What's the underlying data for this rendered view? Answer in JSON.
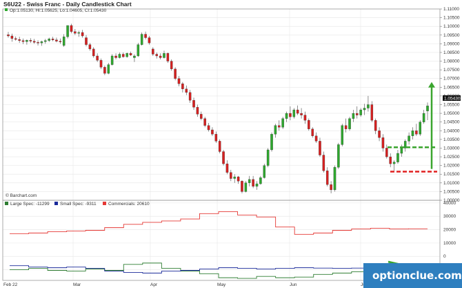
{
  "chart_data": [
    {
      "type": "candlestick",
      "title": "S6U22 - Swiss Franc - Daily Candlestick Chart",
      "ohlc_label": "Op:1.05130, Hi:1.05625, Lo:1.04605, Cl:1.05430",
      "last_price_label": "1.05430",
      "credit": "© Barchart.com",
      "ylim": [
        1.0,
        1.11
      ],
      "y_ticks": [
        "1.00000",
        "1.00500",
        "1.01000",
        "1.01500",
        "1.02000",
        "1.02500",
        "1.03000",
        "1.03500",
        "1.04000",
        "1.04500",
        "1.05000",
        "1.05500",
        "1.06000",
        "1.06500",
        "1.07000",
        "1.07500",
        "1.08000",
        "1.08500",
        "1.09000",
        "1.09500",
        "1.10000",
        "1.10500",
        "1.11000"
      ],
      "x_ticks": [
        "Feb 22",
        "Mar",
        "Apr",
        "May",
        "Jun",
        "Jul"
      ],
      "up_color": "#2ea82e",
      "down_color": "#d62020",
      "candles": [
        [
          1.0952,
          1.0968,
          1.0935,
          1.0945
        ],
        [
          1.0945,
          1.0958,
          1.0912,
          1.093
        ],
        [
          1.093,
          1.0942,
          1.0918,
          1.0925
        ],
        [
          1.0925,
          1.094,
          1.0905,
          1.0918
        ],
        [
          1.0918,
          1.093,
          1.0898,
          1.0912
        ],
        [
          1.0912,
          1.0925,
          1.0895,
          1.092
        ],
        [
          1.092,
          1.0932,
          1.0905,
          1.0915
        ],
        [
          1.0915,
          1.0928,
          1.09,
          1.0908
        ],
        [
          1.0908,
          1.092,
          1.089,
          1.0905
        ],
        [
          1.0905,
          1.0918,
          1.0888,
          1.0912
        ],
        [
          1.0912,
          1.0928,
          1.09,
          1.0918
        ],
        [
          1.0918,
          1.0935,
          1.091,
          1.0928
        ],
        [
          1.0928,
          1.094,
          1.0915,
          1.0922
        ],
        [
          1.0922,
          1.0935,
          1.0908,
          1.0915
        ],
        [
          1.0915,
          1.093,
          1.09,
          1.091
        ],
        [
          1.089,
          1.0955,
          1.0882,
          1.094
        ],
        [
          1.094,
          1.098,
          1.093,
          1.1005
        ],
        [
          1.1005,
          1.1015,
          1.096,
          1.097
        ],
        [
          1.097,
          1.0985,
          1.095,
          1.096
        ],
        [
          1.096,
          1.0975,
          1.094,
          1.0965
        ],
        [
          1.0965,
          1.098,
          1.0935,
          1.0945
        ],
        [
          1.0935,
          1.095,
          1.0885,
          1.0895
        ],
        [
          1.0895,
          1.0905,
          1.086,
          1.087
        ],
        [
          1.087,
          1.088,
          1.082,
          1.083
        ],
        [
          1.083,
          1.0845,
          1.0795,
          1.0805
        ],
        [
          1.0805,
          1.0815,
          1.0755,
          1.0765
        ],
        [
          1.0765,
          1.0775,
          1.072,
          1.073
        ],
        [
          1.073,
          1.079,
          1.0725,
          1.078
        ],
        [
          1.078,
          1.084,
          1.0775,
          1.083
        ],
        [
          1.083,
          1.0845,
          1.081,
          1.082
        ],
        [
          1.082,
          1.085,
          1.0815,
          1.084
        ],
        [
          1.084,
          1.085,
          1.082,
          1.0825
        ],
        [
          1.0825,
          1.085,
          1.082,
          1.0845
        ],
        [
          1.0845,
          1.0855,
          1.083,
          1.0835
        ],
        [
          1.082,
          1.084,
          1.0795,
          1.083
        ],
        [
          1.083,
          1.0905,
          1.0825,
          1.0895
        ],
        [
          1.0895,
          1.0965,
          1.089,
          1.0955
        ],
        [
          1.0955,
          1.097,
          1.0925,
          1.0935
        ],
        [
          1.0935,
          1.0945,
          1.0895,
          1.0905
        ],
        [
          1.087,
          1.088,
          1.083,
          1.084
        ],
        [
          1.084,
          1.085,
          1.0815,
          1.083
        ],
        [
          1.083,
          1.0845,
          1.081,
          1.082
        ],
        [
          1.082,
          1.086,
          1.0815,
          1.0845
        ],
        [
          1.0845,
          1.085,
          1.079,
          1.08
        ],
        [
          1.08,
          1.081,
          1.0745,
          1.0755
        ],
        [
          1.0755,
          1.0765,
          1.069,
          1.07
        ],
        [
          1.07,
          1.0715,
          1.0655,
          1.067
        ],
        [
          1.067,
          1.068,
          1.062,
          1.064
        ],
        [
          1.064,
          1.066,
          1.0605,
          1.062
        ],
        [
          1.062,
          1.0635,
          1.056,
          1.0575
        ],
        [
          1.0575,
          1.059,
          1.052,
          1.0535
        ],
        [
          1.0535,
          1.055,
          1.048,
          1.0495
        ],
        [
          1.0495,
          1.051,
          1.046,
          1.047
        ],
        [
          1.047,
          1.048,
          1.042,
          1.043
        ],
        [
          1.043,
          1.0445,
          1.0395,
          1.0405
        ],
        [
          1.0405,
          1.042,
          1.037,
          1.038
        ],
        [
          1.038,
          1.0395,
          1.033,
          1.034
        ],
        [
          1.034,
          1.035,
          1.027,
          1.028
        ],
        [
          1.028,
          1.029,
          1.02,
          1.021
        ],
        [
          1.021,
          1.023,
          1.015,
          1.016
        ],
        [
          1.016,
          1.0175,
          1.011,
          1.0125
        ],
        [
          1.0125,
          1.015,
          1.01,
          1.0135
        ],
        [
          1.0135,
          1.014,
          1.0095,
          1.011
        ],
        [
          1.011,
          1.0115,
          1.004,
          1.005
        ],
        [
          1.005,
          1.011,
          1.0045,
          1.01
        ],
        [
          1.01,
          1.014,
          1.008,
          1.012
        ],
        [
          1.012,
          1.014,
          1.007,
          1.008
        ],
        [
          1.008,
          1.011,
          1.006,
          1.0095
        ],
        [
          1.0095,
          1.014,
          1.009,
          1.013
        ],
        [
          1.013,
          1.021,
          1.0125,
          1.02
        ],
        [
          1.02,
          1.03,
          1.019,
          1.029
        ],
        [
          1.029,
          1.039,
          1.028,
          1.038
        ],
        [
          1.038,
          1.044,
          1.036,
          1.043
        ],
        [
          1.043,
          1.046,
          1.04,
          1.042
        ],
        [
          1.042,
          1.048,
          1.041,
          1.047
        ],
        [
          1.047,
          1.051,
          1.045,
          1.05
        ],
        [
          1.05,
          1.054,
          1.046,
          1.048
        ],
        [
          1.048,
          1.053,
          1.047,
          1.052
        ],
        [
          1.052,
          1.0545,
          1.049,
          1.05
        ],
        [
          1.05,
          1.053,
          1.047,
          1.049
        ],
        [
          1.049,
          1.051,
          1.044,
          1.046
        ],
        [
          1.046,
          1.047,
          1.04,
          1.041
        ],
        [
          1.041,
          1.042,
          1.036,
          1.037
        ],
        [
          1.037,
          1.039,
          1.033,
          1.034
        ],
        [
          1.034,
          1.036,
          1.025,
          1.026
        ],
        [
          1.026,
          1.028,
          1.016,
          1.017
        ],
        [
          1.017,
          1.019,
          1.008,
          1.009
        ],
        [
          1.009,
          1.011,
          1.004,
          1.006
        ],
        [
          1.006,
          1.02,
          1.005,
          1.019
        ],
        [
          1.019,
          1.033,
          1.018,
          1.032
        ],
        [
          1.032,
          1.044,
          1.031,
          1.043
        ],
        [
          1.043,
          1.047,
          1.039,
          1.041
        ],
        [
          1.041,
          1.048,
          1.04,
          1.047
        ],
        [
          1.047,
          1.052,
          1.045,
          1.05
        ],
        [
          1.05,
          1.054,
          1.047,
          1.049
        ],
        [
          1.049,
          1.053,
          1.048,
          1.052
        ],
        [
          1.052,
          1.0555,
          1.049,
          1.053
        ],
        [
          1.053,
          1.06,
          1.051,
          1.055
        ],
        [
          1.055,
          1.057,
          1.045,
          1.046
        ],
        [
          1.046,
          1.047,
          1.038,
          1.04
        ],
        [
          1.04,
          1.042,
          1.034,
          1.036
        ],
        [
          1.036,
          1.038,
          1.028,
          1.03
        ],
        [
          1.03,
          1.032,
          1.024,
          1.025
        ],
        [
          1.025,
          1.027,
          1.019,
          1.021
        ],
        [
          1.021,
          1.023,
          1.017,
          1.022
        ],
        [
          1.022,
          1.029,
          1.021,
          1.027
        ],
        [
          1.027,
          1.032,
          1.025,
          1.03
        ],
        [
          1.03,
          1.035,
          1.028,
          1.034
        ],
        [
          1.034,
          1.039,
          1.032,
          1.037
        ],
        [
          1.037,
          1.042,
          1.035,
          1.04
        ],
        [
          1.04,
          1.044,
          1.037,
          1.038
        ],
        [
          1.038,
          1.046,
          1.037,
          1.045
        ],
        [
          1.045,
          1.052,
          1.044,
          1.05
        ],
        [
          1.0513,
          1.05625,
          1.04605,
          1.0543
        ]
      ],
      "annotations": {
        "arrow_up_from": 1.018,
        "arrow_up_to": 1.068,
        "arrow_color": "#3aa52e",
        "green_dash_level": 1.0305,
        "red_dash_level": 1.0165,
        "red_dash_color": "#e02020"
      }
    },
    {
      "type": "line",
      "legend": [
        {
          "name": "Large Spec: -11299",
          "color": "#2e7d32"
        },
        {
          "name": "Small Spec: -9311",
          "color": "#1a2a9a"
        },
        {
          "name": "Commercials: 20610",
          "color": "#e53935"
        }
      ],
      "ylim": [
        -18000,
        42000
      ],
      "y_ticks": [
        "-10000",
        "0",
        "10000",
        "20000",
        "30000",
        "40000"
      ],
      "x_ticks": [
        "Feb 22",
        "Mar",
        "Apr",
        "May",
        "Jun",
        "Jul"
      ],
      "weeks": 22,
      "series": [
        {
          "name": "Commercials",
          "color": "#e53935",
          "values": [
            17000,
            17500,
            18500,
            19000,
            19500,
            21500,
            24000,
            25500,
            26500,
            28000,
            32000,
            33500,
            31000,
            29500,
            22000,
            16500,
            17500,
            19500,
            20500,
            21000,
            20500,
            20610
          ]
        },
        {
          "name": "Large Spec",
          "color": "#2e7d32",
          "values": [
            -10000,
            -9000,
            -10500,
            -11000,
            -9500,
            -10500,
            -6000,
            -5000,
            -9000,
            -11000,
            -13000,
            -16000,
            -16500,
            -15000,
            -16000,
            -15500,
            -13500,
            -12500,
            -11500,
            -11800,
            -11600,
            -11299
          ]
        },
        {
          "name": "Small Spec",
          "color": "#1a2a9a",
          "values": [
            -7000,
            -8000,
            -8500,
            -8000,
            -9000,
            -11000,
            -12000,
            -12500,
            -11000,
            -10500,
            -9500,
            -8500,
            -9000,
            -9500,
            -9000,
            -8500,
            -8800,
            -9000,
            -8800,
            -9100,
            -9200,
            -9311
          ]
        }
      ],
      "annotation_arrow_color": "#3aa52e"
    }
  ],
  "watermark": "optionclue.com"
}
